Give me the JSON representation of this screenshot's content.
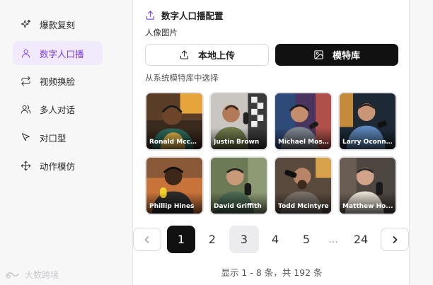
{
  "sidebar": {
    "items": [
      {
        "label": "爆款复刻",
        "icon": "sparkle-icon"
      },
      {
        "label": "数字人口播",
        "icon": "user-icon",
        "active": true
      },
      {
        "label": "视频换脸",
        "icon": "swap-icon"
      },
      {
        "label": "多人对话",
        "icon": "users-icon"
      },
      {
        "label": "对口型",
        "icon": "cursor-icon"
      },
      {
        "label": "动作模仿",
        "icon": "move-icon"
      }
    ],
    "watermark": "大数跨境"
  },
  "panel": {
    "title": "数字人口播配置",
    "avatar_label": "人像图片",
    "upload_button": "本地上传",
    "library_button": "模特库",
    "choose_label": "从系统模特库中选择",
    "models": [
      {
        "name": "Ronald Mccu..."
      },
      {
        "name": "Justin Brown"
      },
      {
        "name": "Michael Mosl..."
      },
      {
        "name": "Larry Oconnor"
      },
      {
        "name": "Phillip Hines"
      },
      {
        "name": "David Griffith"
      },
      {
        "name": "Todd Mcintyre"
      },
      {
        "name": "Matthew Ho..."
      }
    ]
  },
  "pagination": {
    "pages": [
      "1",
      "2",
      "3",
      "4",
      "5",
      "...",
      "24"
    ],
    "current": "1",
    "summary": "显示 1 - 8 条，共 192 条"
  },
  "colors": {
    "accent": "#7c3aed",
    "active_bg": "#f1eafd",
    "primary_button": "#111111"
  }
}
